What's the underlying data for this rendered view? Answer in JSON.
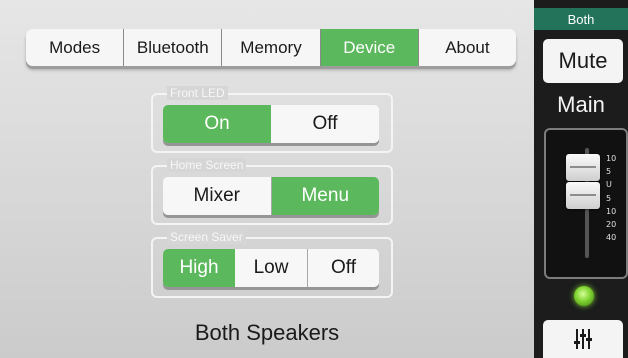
{
  "tabs": [
    {
      "label": "Modes",
      "active": false
    },
    {
      "label": "Bluetooth",
      "active": false
    },
    {
      "label": "Memory",
      "active": false
    },
    {
      "label": "Device",
      "active": true
    },
    {
      "label": "About",
      "active": false
    }
  ],
  "front_led": {
    "label": "Front LED",
    "options": [
      "On",
      "Off"
    ],
    "selected": "On"
  },
  "home_screen": {
    "label": "Home Screen",
    "options": [
      "Mixer",
      "Menu"
    ],
    "selected": "Menu"
  },
  "screen_saver": {
    "label": "Screen Saver",
    "options": [
      "High",
      "Low",
      "Off"
    ],
    "selected": "High"
  },
  "footer": {
    "text": "Both Speakers"
  },
  "strip": {
    "header": "Both",
    "mute_label": "Mute",
    "channel_label": "Main",
    "fader_scale": [
      "10",
      "5",
      "U",
      "5",
      "10",
      "20",
      "40"
    ],
    "led_color": "#7fd330",
    "eq_icon": "eq-sliders-icon"
  },
  "colors": {
    "accent": "#5cb85c",
    "strip_header": "#23725a"
  }
}
